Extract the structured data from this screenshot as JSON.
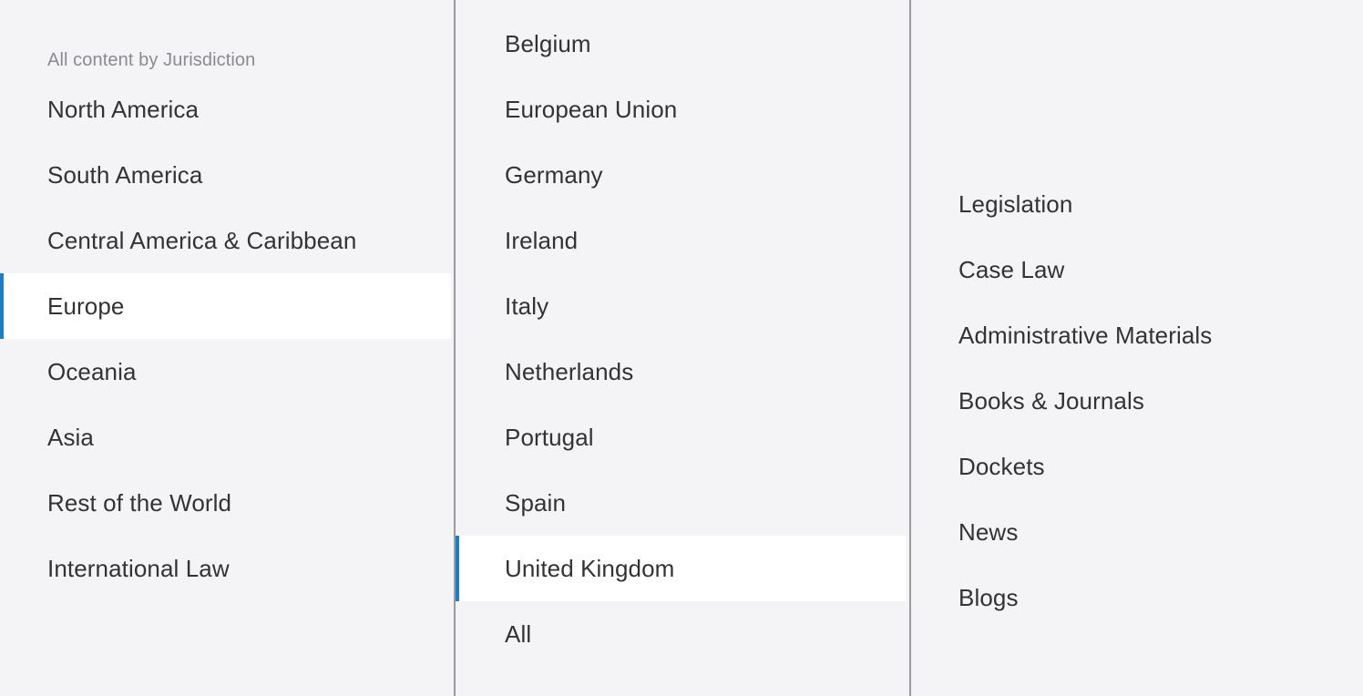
{
  "accent_color": "#1a7fc9",
  "background_color": "#f4f4f6",
  "selected_background_color": "#ffffff",
  "divider_color": "#9a9aa3",
  "text_color": "#333336",
  "header_text_color": "#8a8a90",
  "columns": {
    "jurisdiction": {
      "header": "All content by Jurisdiction",
      "items": [
        {
          "label": "North America",
          "selected": false
        },
        {
          "label": "South America",
          "selected": false
        },
        {
          "label": "Central America & Caribbean",
          "selected": false
        },
        {
          "label": "Europe",
          "selected": true
        },
        {
          "label": "Oceania",
          "selected": false
        },
        {
          "label": "Asia",
          "selected": false
        },
        {
          "label": "Rest of the World",
          "selected": false
        },
        {
          "label": "International Law",
          "selected": false
        }
      ]
    },
    "country": {
      "items": [
        {
          "label": "Belgium",
          "selected": false
        },
        {
          "label": "European Union",
          "selected": false
        },
        {
          "label": "Germany",
          "selected": false
        },
        {
          "label": "Ireland",
          "selected": false
        },
        {
          "label": "Italy",
          "selected": false
        },
        {
          "label": "Netherlands",
          "selected": false
        },
        {
          "label": "Portugal",
          "selected": false
        },
        {
          "label": "Spain",
          "selected": false
        },
        {
          "label": "United Kingdom",
          "selected": true
        },
        {
          "label": "All",
          "selected": false
        }
      ]
    },
    "content_type": {
      "items": [
        {
          "label": "Legislation",
          "selected": false
        },
        {
          "label": "Case Law",
          "selected": false
        },
        {
          "label": "Administrative Materials",
          "selected": false
        },
        {
          "label": "Books & Journals",
          "selected": false
        },
        {
          "label": "Dockets",
          "selected": false
        },
        {
          "label": "News",
          "selected": false
        },
        {
          "label": "Blogs",
          "selected": false
        }
      ]
    }
  }
}
